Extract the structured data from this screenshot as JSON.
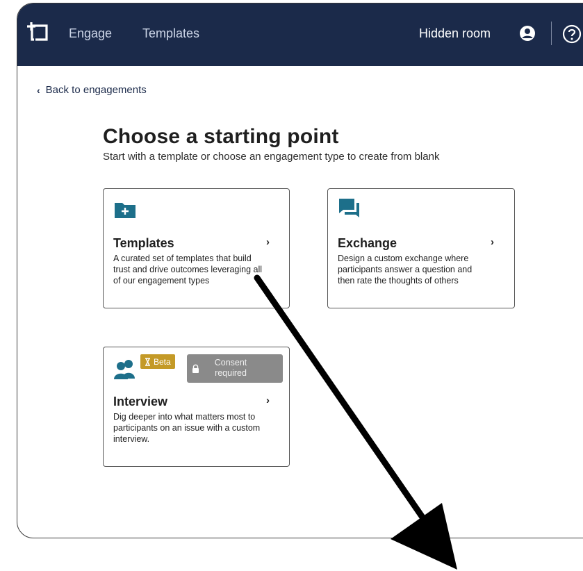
{
  "header": {
    "nav_engage": "Engage",
    "nav_templates": "Templates",
    "room_name": "Hidden room",
    "icons": {
      "logo": "add-board-icon",
      "user": "user-circle-icon",
      "help": "question-circle-icon"
    },
    "colors": {
      "bar": "#1b2a4a"
    }
  },
  "back_link": "Back to engagements",
  "page": {
    "title": "Choose a starting point",
    "subtitle": "Start with a template or choose an engagement type to create from blank"
  },
  "cards": [
    {
      "id": "templates",
      "icon": "folder-plus-icon",
      "title": "Templates",
      "description": "A curated set of templates that build trust and drive outcomes leveraging all of our engagement types"
    },
    {
      "id": "exchange",
      "icon": "chat-bubbles-icon",
      "title": "Exchange",
      "description": "Design a custom exchange where participants answer a question and then rate the thoughts of others"
    },
    {
      "id": "interview",
      "icon": "people-icon",
      "title": "Interview",
      "badges": {
        "beta": "Beta",
        "consent": "Consent required"
      },
      "description": "Dig deeper into what matters most to participants on an issue with a custom interview."
    }
  ],
  "colors": {
    "accent": "#1d6f8a",
    "beta": "#c49a27",
    "consent": "#8a8a8a"
  }
}
